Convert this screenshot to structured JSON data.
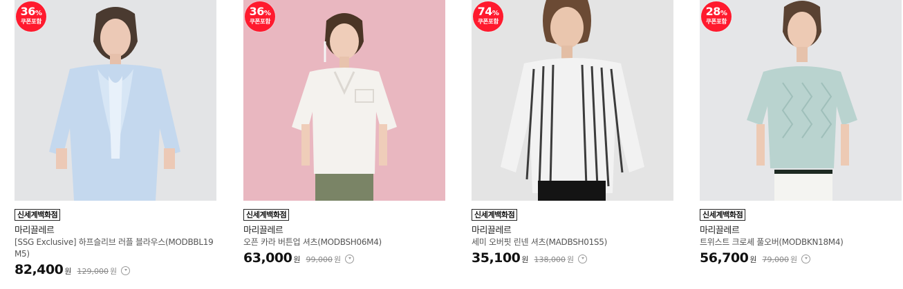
{
  "products": [
    {
      "discount": "36",
      "discount_unit": "%",
      "coupon_label": "쿠폰포함",
      "store": "신세계백화점",
      "brand": "마리끌레르",
      "title": "[SSG Exclusive] 하프슬리브 러플 블라우스(MODBBL19M5)",
      "price": "82,400",
      "currency": "원",
      "original_price": "129,000",
      "bg_color": "#e3e4e6",
      "garment_color": "#c4d8ee"
    },
    {
      "discount": "36",
      "discount_unit": "%",
      "coupon_label": "쿠폰포함",
      "store": "신세계백화점",
      "brand": "마리끌레르",
      "title": "오픈 카라 버튼업 셔츠(MODBSH06M4)",
      "price": "63,000",
      "currency": "원",
      "original_price": "99,000",
      "bg_color": "#e9b7c0",
      "garment_color": "#f4f2ee"
    },
    {
      "discount": "74",
      "discount_unit": "%",
      "coupon_label": "쿠폰포함",
      "store": "신세계백화점",
      "brand": "마리끌레르",
      "title": "세미 오버핏 린넨 셔츠(MADBSH01S5)",
      "price": "35,100",
      "currency": "원",
      "original_price": "138,000",
      "bg_color": "#e4e4e4",
      "garment_color": "#f2f2f2"
    },
    {
      "discount": "28",
      "discount_unit": "%",
      "coupon_label": "쿠폰포함",
      "store": "신세계백화점",
      "brand": "마리끌레르",
      "title": "트위스트 크로셰 풀오버(MODBKN18M4)",
      "price": "56,700",
      "currency": "원",
      "original_price": "79,000",
      "bg_color": "#e5e6e8",
      "garment_color": "#b9d3cf"
    }
  ]
}
